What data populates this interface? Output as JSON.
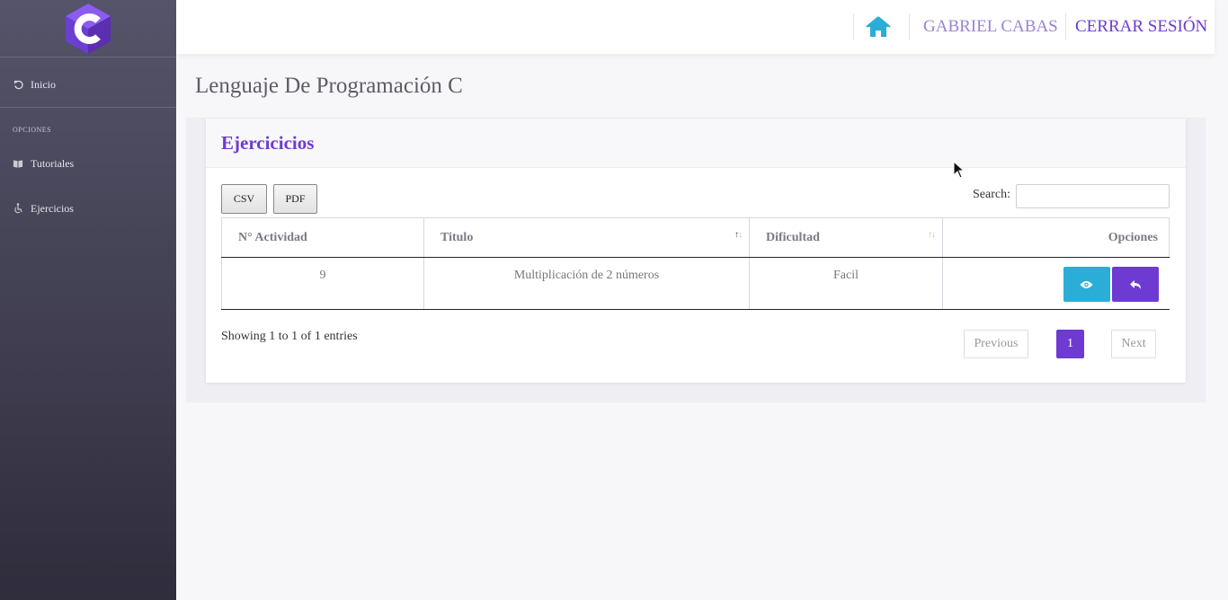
{
  "sidebar": {
    "items": [
      {
        "label": "Inicio",
        "icon": "refresh-icon"
      },
      {
        "label": "Tutoriales",
        "icon": "book-icon"
      },
      {
        "label": "Ejercicios",
        "icon": "wheelchair-icon"
      }
    ],
    "section_label": "OPCIONES"
  },
  "topbar": {
    "user_name": "GABRIEL CABAS",
    "logout_label": "CERRAR SESIÓN"
  },
  "page": {
    "title": "Lenguaje De Programación C"
  },
  "card": {
    "title": "Ejercicicios",
    "csv_label": "CSV",
    "pdf_label": "PDF",
    "search_label": "Search:",
    "search_value": "",
    "table": {
      "headers": [
        "N° Actividad",
        "Titulo",
        "Dificultad",
        "Opciones"
      ],
      "rows": [
        {
          "numero": "9",
          "titulo": "Multiplicación de 2 números",
          "dificultad": "Facil"
        }
      ]
    },
    "info": "Showing 1 to 1 of 1 entries",
    "pagination": {
      "previous": "Previous",
      "current": "1",
      "next": "Next"
    }
  },
  "colors": {
    "accent": "#6d3bd1",
    "view_button": "#2aaed8",
    "sidebar_top": "#55546a",
    "sidebar_bottom": "#2f2d3c"
  }
}
